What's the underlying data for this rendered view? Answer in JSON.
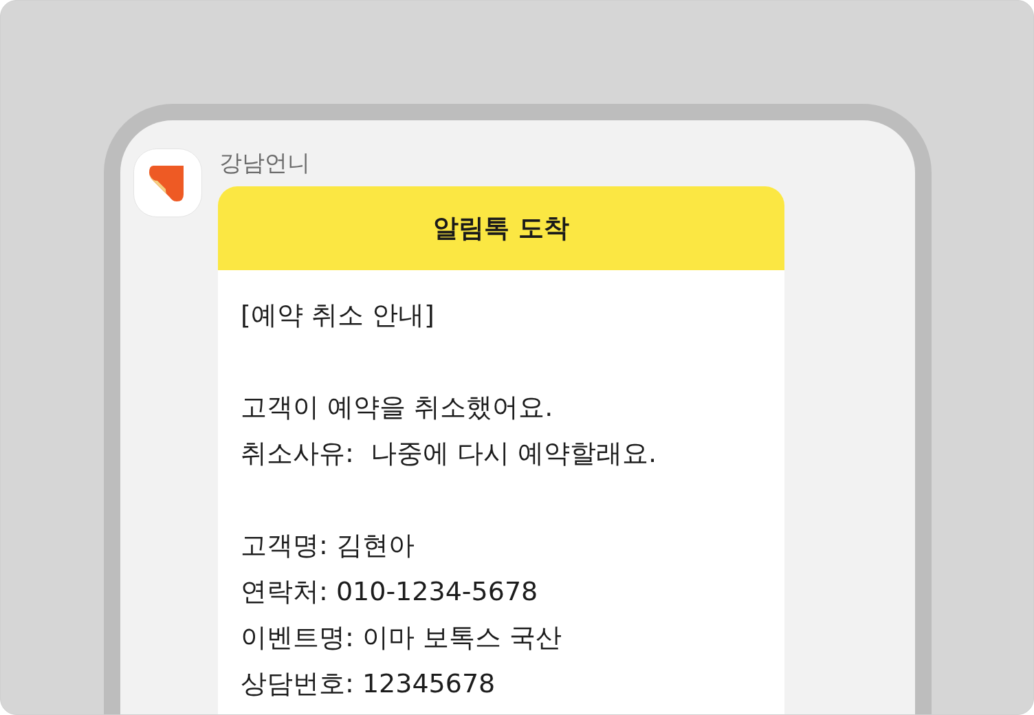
{
  "sender": {
    "name": "강남언니"
  },
  "message": {
    "header": "알림톡 도착",
    "paragraphs": [
      [
        "[예약 취소 안내]"
      ],
      [
        "고객이 예약을 취소했어요.",
        "취소사유:  나중에 다시 예약할래요."
      ],
      [
        "고객명: 김현아",
        "연락처: 010-1234-5678",
        "이벤트명: 이마 보톡스 국산",
        "상담번호: 12345678"
      ]
    ]
  }
}
